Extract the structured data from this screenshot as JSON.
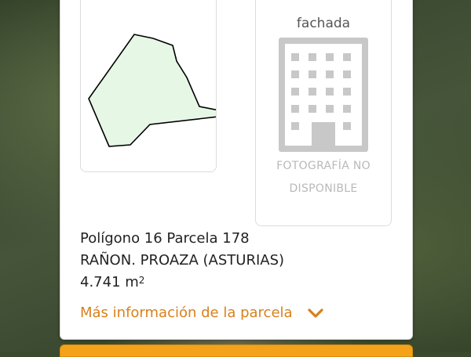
{
  "colors": {
    "accent": "#d9801a",
    "plot_fill": "#e6f7e6",
    "placeholder_gray": "#c8c8c8",
    "action_bar": "#f4a21a"
  },
  "photo": {
    "title": "fachada",
    "icon": "building-icon",
    "unavailable_line1": "FOTOGRAFÍA NO",
    "unavailable_line2": "DISPONIBLE"
  },
  "parcel": {
    "plot_icon": "parcel-shape-icon",
    "line1": "Polígono 16 Parcela 178",
    "line2": "RAÑON. PROAZA (ASTURIAS)",
    "area_value": "4.741 m",
    "area_unit_sup": "2"
  },
  "more_info": {
    "label": "Más información de la parcela",
    "icon": "chevron-down-icon"
  }
}
